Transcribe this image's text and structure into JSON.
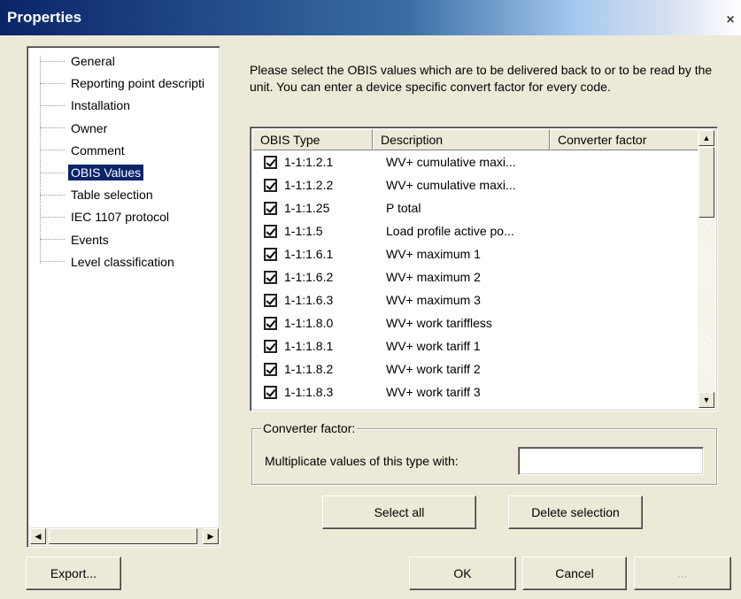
{
  "window": {
    "title": "Properties",
    "close_glyph": "×"
  },
  "tree": {
    "items": [
      {
        "label": "General"
      },
      {
        "label": "Reporting point descripti"
      },
      {
        "label": "Installation"
      },
      {
        "label": "Owner"
      },
      {
        "label": "Comment"
      },
      {
        "label": "OBIS Values",
        "selected": true
      },
      {
        "label": "Table selection"
      },
      {
        "label": "IEC 1107 protocol"
      },
      {
        "label": "Events"
      },
      {
        "label": "Level classification"
      }
    ]
  },
  "instruction": "Please select the OBIS values which are to be delivered back to or to be read by the unit. You can enter a device specific convert factor for every code.",
  "list": {
    "columns": [
      "OBIS Type",
      "Description",
      "Converter factor"
    ],
    "rows": [
      {
        "type": "1-1:1.2.1",
        "desc": "WV+ cumulative maxi...",
        "factor": "",
        "checked": true
      },
      {
        "type": "1-1:1.2.2",
        "desc": "WV+ cumulative maxi...",
        "factor": "",
        "checked": true
      },
      {
        "type": "1-1:1.25",
        "desc": "P total",
        "factor": "",
        "checked": true
      },
      {
        "type": "1-1:1.5",
        "desc": "Load profile active po...",
        "factor": "",
        "checked": true
      },
      {
        "type": "1-1:1.6.1",
        "desc": "WV+ maximum 1",
        "factor": "",
        "checked": true
      },
      {
        "type": "1-1:1.6.2",
        "desc": "WV+ maximum 2",
        "factor": "",
        "checked": true
      },
      {
        "type": "1-1:1.6.3",
        "desc": "WV+ maximum 3",
        "factor": "",
        "checked": true
      },
      {
        "type": "1-1:1.8.0",
        "desc": "WV+ work tariffless",
        "factor": "",
        "checked": true
      },
      {
        "type": "1-1:1.8.1",
        "desc": "WV+ work tariff 1",
        "factor": "",
        "checked": true
      },
      {
        "type": "1-1:1.8.2",
        "desc": "WV+ work tariff 2",
        "factor": "",
        "checked": true
      },
      {
        "type": "1-1:1.8.3",
        "desc": "WV+ work tariff 3",
        "factor": "",
        "checked": true
      }
    ]
  },
  "converter": {
    "legend": "Converter factor:",
    "label": "Multiplicate values of this type with:",
    "value": ""
  },
  "buttons": {
    "select_all": "Select all",
    "delete_selection": "Delete selection",
    "export": "Export...",
    "ok": "OK",
    "cancel": "Cancel",
    "apply": "..."
  }
}
